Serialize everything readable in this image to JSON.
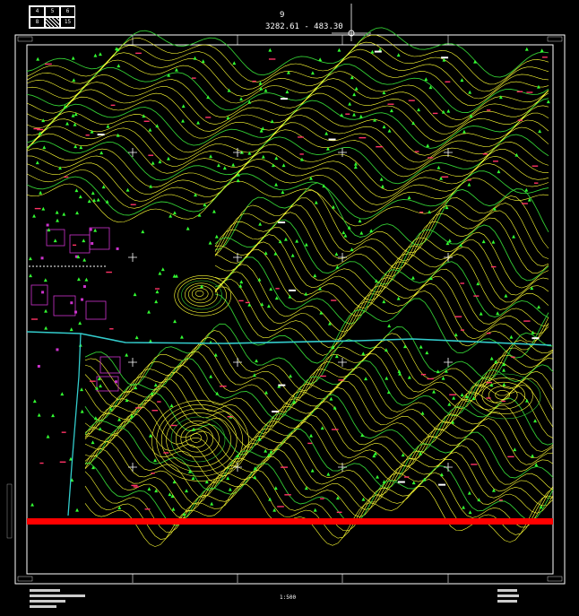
{
  "index_table": {
    "cells": [
      "4",
      "5",
      "6",
      "8",
      "",
      "15"
    ],
    "shaded_index": 4
  },
  "sheet": {
    "number": "9",
    "coordinate": "3282.61 - 483.30"
  },
  "scale": "1:500",
  "colors": {
    "background": "#000000",
    "contour_main": "#ffff33",
    "contour_index": "#33cc33",
    "vegetation": "#33ff33",
    "building": "#cc33cc",
    "road": "#33cccc",
    "highlight": "#ff0000",
    "frame": "#ffffff",
    "labels": "#ff3366"
  },
  "icons": {
    "vegetation": "tree-symbol",
    "grid": "grid-cross"
  }
}
